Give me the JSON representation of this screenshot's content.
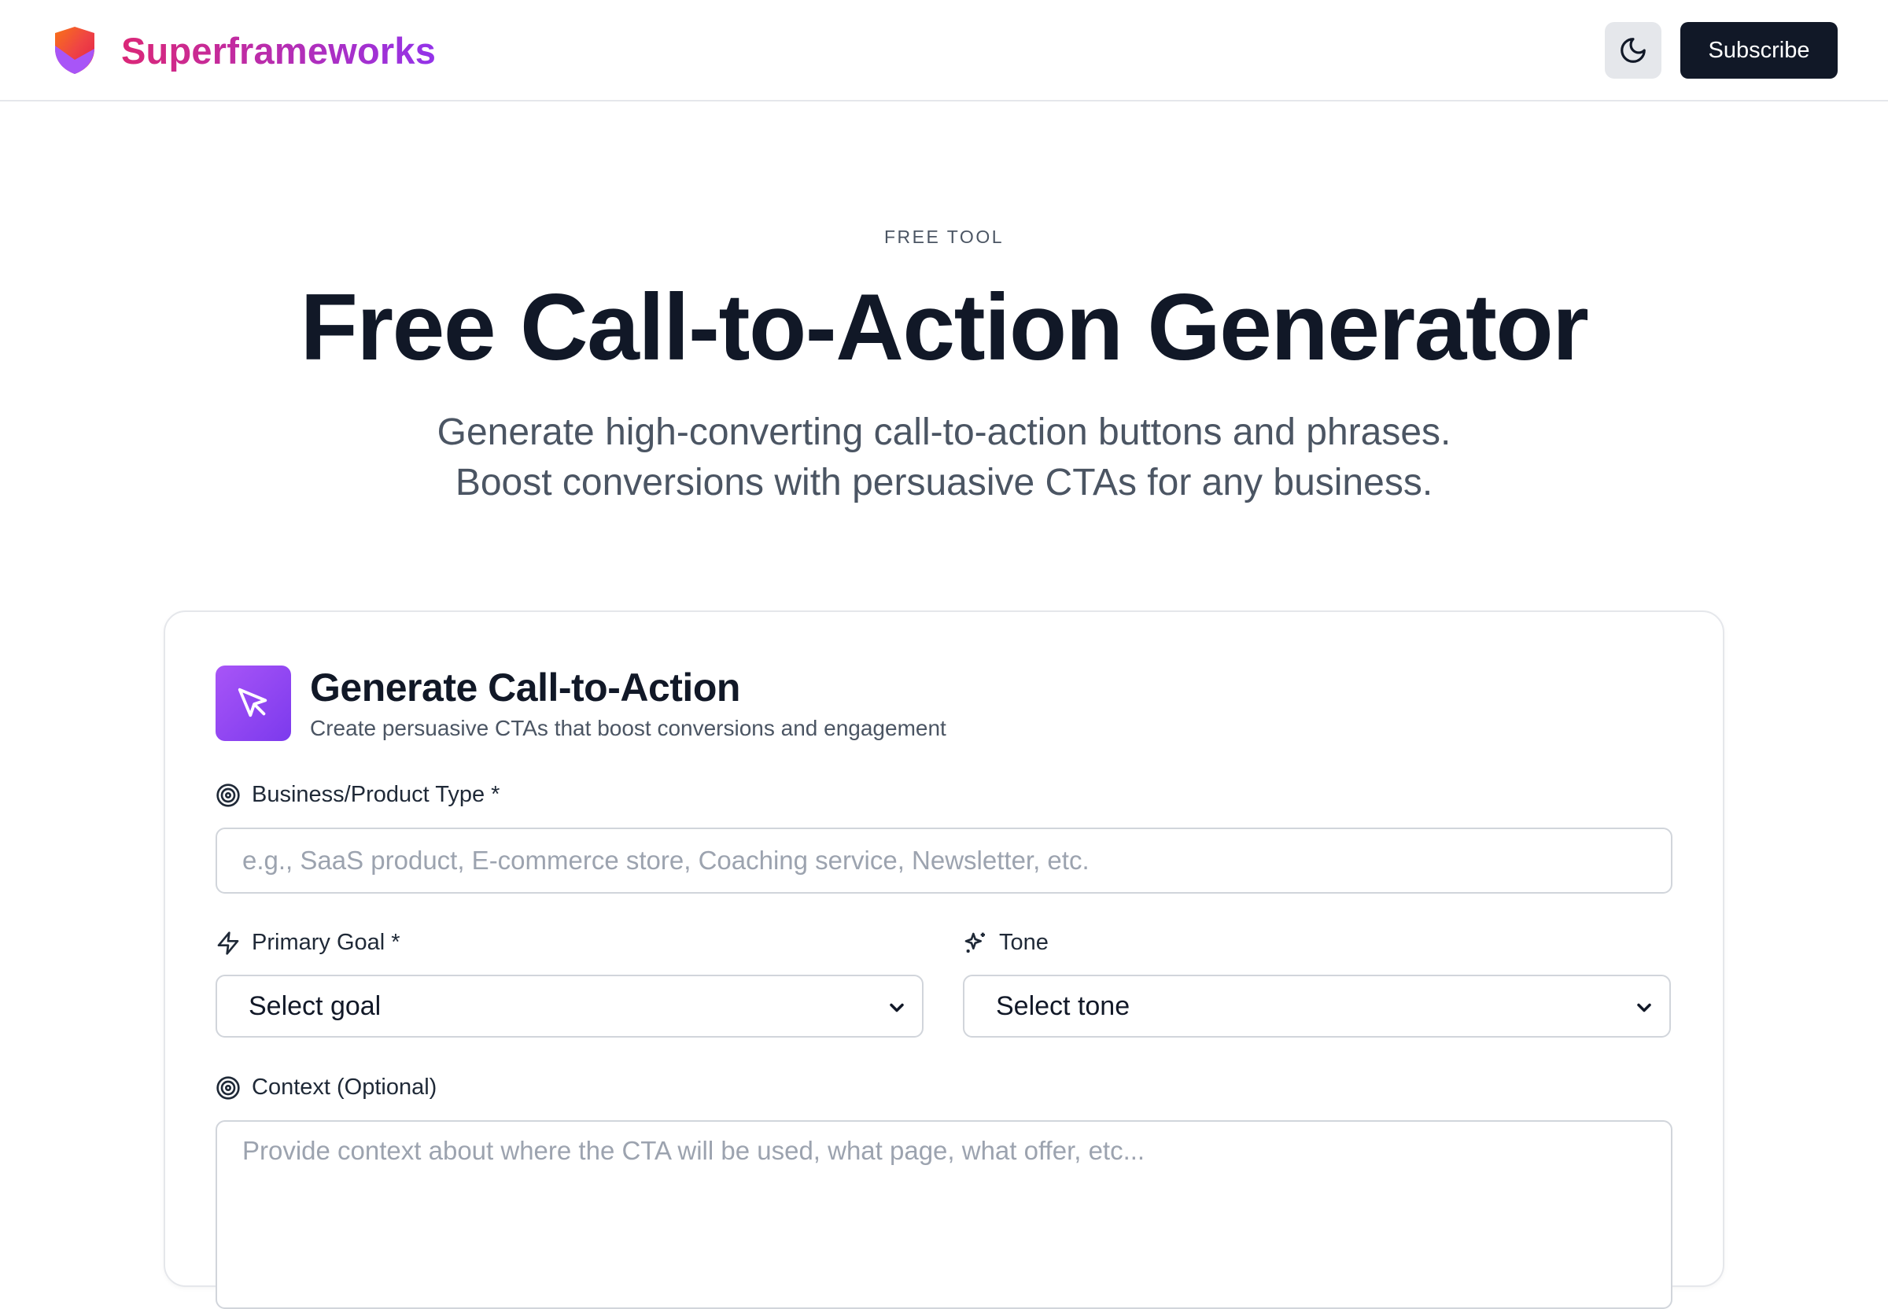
{
  "header": {
    "brand_name": "Superframeworks",
    "subscribe_label": "Subscribe",
    "theme_toggle_icon": "moon-icon",
    "logo_icon": "shield-logo-icon"
  },
  "hero": {
    "eyebrow": "FREE TOOL",
    "title": "Free Call-to-Action Generator",
    "subtitle_line1": "Generate high-converting call-to-action buttons and phrases.",
    "subtitle_line2": "Boost conversions with persuasive CTAs for any business."
  },
  "card": {
    "icon": "cursor-pointer-icon",
    "title": "Generate Call-to-Action",
    "description": "Create persuasive CTAs that boost conversions and engagement",
    "fields": {
      "business": {
        "icon": "target-icon",
        "label": "Business/Product Type *",
        "value": "",
        "placeholder": "e.g., SaaS product, E-commerce store, Coaching service, Newsletter, etc."
      },
      "goal": {
        "icon": "lightning-icon",
        "label": "Primary Goal *",
        "selected": "Select goal"
      },
      "tone": {
        "icon": "sparkles-icon",
        "label": "Tone",
        "selected": "Select tone"
      },
      "context": {
        "icon": "target-icon",
        "label": "Context (Optional)",
        "value": "",
        "placeholder": "Provide context about where the CTA will be used, what page, what offer, etc..."
      }
    }
  },
  "colors": {
    "brand_gradient_start": "#db2777",
    "brand_gradient_end": "#9333ea",
    "card_icon_bg": "#8b5cf6",
    "subscribe_bg": "#111827",
    "theme_btn_bg": "#e5e7eb"
  }
}
